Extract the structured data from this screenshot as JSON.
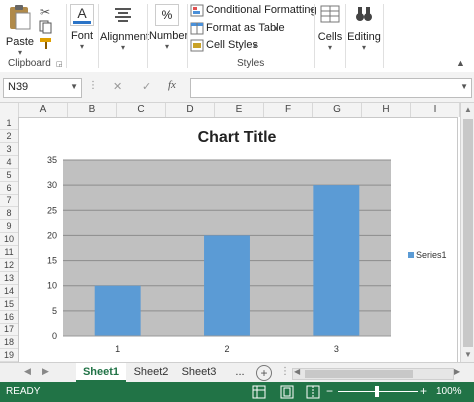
{
  "ribbon": {
    "clipboard": {
      "paste_label": "Paste",
      "group_label": "Clipboard"
    },
    "font_label": "Font",
    "alignment_label": "Alignment",
    "number_label": "Number",
    "styles": {
      "conditional_formatting": "Conditional Formatting",
      "format_as_table": "Format as Table",
      "cell_styles": "Cell Styles",
      "group_label": "Styles"
    },
    "cells_label": "Cells",
    "editing_label": "Editing",
    "number_glyph": "%",
    "font_glyph": "A"
  },
  "formula_bar": {
    "name_box": "N39",
    "cancel_glyph": "✕",
    "enter_glyph": "✓",
    "fx_glyph": "fx",
    "formula": ""
  },
  "grid": {
    "columns": [
      "A",
      "B",
      "C",
      "D",
      "E",
      "F",
      "G",
      "H",
      "I"
    ],
    "rows": [
      "1",
      "2",
      "3",
      "4",
      "5",
      "6",
      "7",
      "8",
      "9",
      "10",
      "11",
      "12",
      "13",
      "14",
      "15",
      "16",
      "17",
      "18",
      "19"
    ]
  },
  "chart_data": {
    "type": "bar",
    "title": "Chart Title",
    "categories": [
      "1",
      "2",
      "3"
    ],
    "series": [
      {
        "name": "Series1",
        "values": [
          10,
          20,
          30
        ]
      }
    ],
    "ylim": [
      0,
      35
    ],
    "yticks": [
      "0",
      "5",
      "10",
      "15",
      "20",
      "25",
      "30",
      "35"
    ],
    "grid": true,
    "legend": "right",
    "colors": {
      "bar": "#5b9bd5",
      "plot_bg": "#c0c0c0",
      "gridline": "#8c8c8c"
    }
  },
  "sheets": {
    "tabs": [
      "Sheet1",
      "Sheet2",
      "Sheet3"
    ],
    "active": "Sheet1",
    "more": "...",
    "add_glyph": "+"
  },
  "status": {
    "ready": "READY",
    "zoom": "100%",
    "zoom_out": "−",
    "zoom_in": "+"
  }
}
